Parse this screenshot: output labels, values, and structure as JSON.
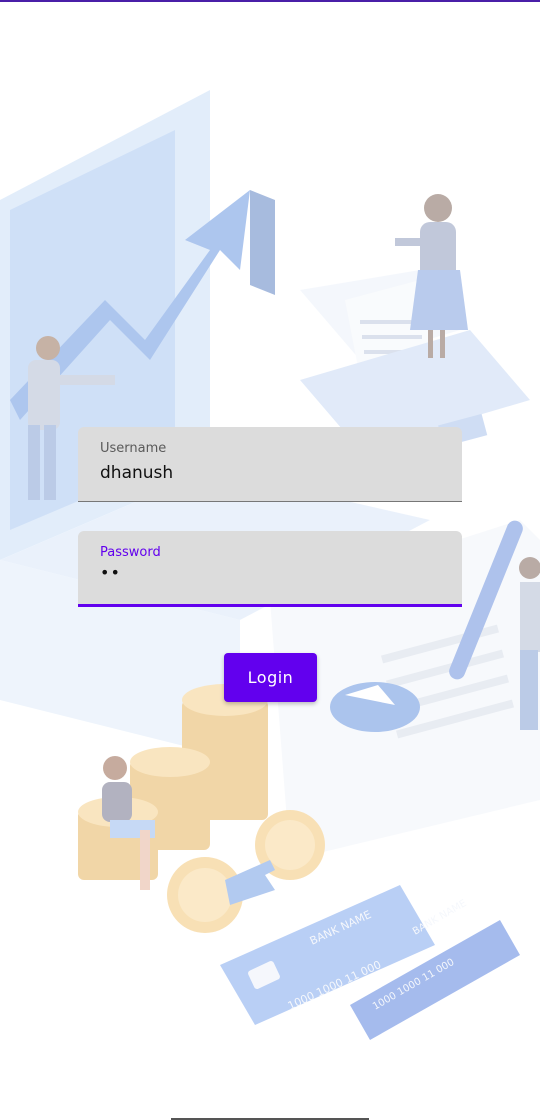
{
  "form": {
    "username_label": "Username",
    "username_value": "dhanush",
    "password_label": "Password",
    "password_value": "••",
    "login_label": "Login"
  },
  "colors": {
    "accent": "#6200ee",
    "field_bg": "#dcdcdc",
    "top_bar": "#4a1fa8"
  },
  "illustration": {
    "card1_text": "1000 1000 11 000",
    "card1_label": "BANK NAME",
    "card2_label": "BANK NAME",
    "card2_text": "1000 1000 11 000"
  }
}
